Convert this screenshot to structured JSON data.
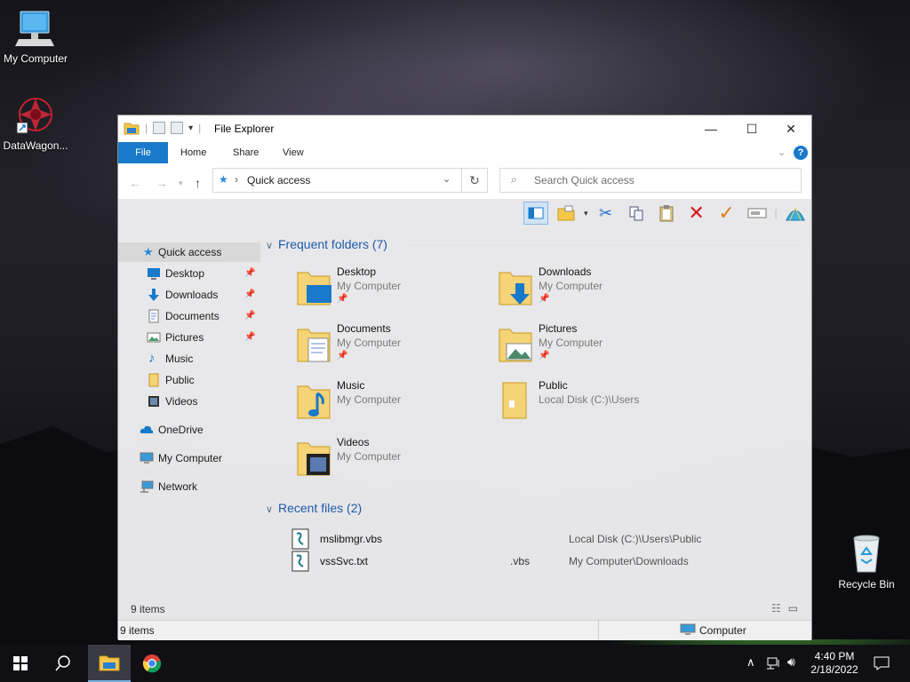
{
  "desktop": {
    "icons": [
      {
        "label": "My Computer",
        "icon": "computer-icon"
      },
      {
        "label": "DataWagon...",
        "icon": "app-shortcut-icon"
      },
      {
        "label": "Recycle Bin",
        "icon": "recycle-bin-icon"
      }
    ]
  },
  "window": {
    "title": "File Explorer",
    "controls": {
      "minimize": "—",
      "maximize": "☐",
      "close": "✕"
    },
    "ribbon_tabs": [
      "File",
      "Home",
      "Share",
      "View"
    ],
    "address": {
      "location_icon": "star-icon",
      "path": "Quick access"
    },
    "search_placeholder": "Search Quick access",
    "toolbar_icons": [
      "preview-pane-icon",
      "new-folder-icon",
      "cut-icon",
      "copy-icon",
      "paste-icon",
      "delete-icon",
      "checkmark-icon",
      "rename-icon",
      "shell-icon"
    ],
    "sidebar": [
      {
        "label": "Quick access",
        "icon": "star-icon",
        "selected": true,
        "pinned": false
      },
      {
        "label": "Desktop",
        "icon": "desktop-icon",
        "pinned": true
      },
      {
        "label": "Downloads",
        "icon": "download-icon",
        "pinned": true
      },
      {
        "label": "Documents",
        "icon": "document-icon",
        "pinned": true
      },
      {
        "label": "Pictures",
        "icon": "pictures-icon",
        "pinned": true
      },
      {
        "label": "Music",
        "icon": "music-icon",
        "pinned": false
      },
      {
        "label": "Public",
        "icon": "folder-icon",
        "pinned": false
      },
      {
        "label": "Videos",
        "icon": "video-icon",
        "pinned": false
      },
      {
        "label": "OneDrive",
        "icon": "cloud-icon",
        "pinned": false
      },
      {
        "label": "My Computer",
        "icon": "computer-icon",
        "pinned": false
      },
      {
        "label": "Network",
        "icon": "network-icon",
        "pinned": false
      }
    ],
    "frequent": {
      "header": "Frequent folders (7)",
      "items": [
        {
          "name": "Desktop",
          "location": "My Computer",
          "pinned": true,
          "icon": "desktop-folder-icon"
        },
        {
          "name": "Downloads",
          "location": "My Computer",
          "pinned": true,
          "icon": "downloads-folder-icon"
        },
        {
          "name": "Documents",
          "location": "My Computer",
          "pinned": true,
          "icon": "documents-folder-icon"
        },
        {
          "name": "Pictures",
          "location": "My Computer",
          "pinned": true,
          "icon": "pictures-folder-icon"
        },
        {
          "name": "Music",
          "location": "My Computer",
          "pinned": false,
          "icon": "music-folder-icon"
        },
        {
          "name": "Public",
          "location": "Local Disk (C:)\\Users",
          "pinned": false,
          "icon": "public-folder-icon"
        },
        {
          "name": "Videos",
          "location": "My Computer",
          "pinned": false,
          "icon": "videos-folder-icon"
        }
      ]
    },
    "recent": {
      "header": "Recent files (2)",
      "items": [
        {
          "name": "mslibmgr.vbs",
          "ext": "",
          "path": "Local Disk (C:)\\Users\\Public",
          "icon": "script-file-icon"
        },
        {
          "name": "vssSvc.txt",
          "ext": ".vbs",
          "path": "My Computer\\Downloads",
          "icon": "script-file-icon"
        }
      ]
    },
    "status_top": "9 items",
    "status_bottom": "9 items",
    "status_location": "Computer"
  },
  "taskbar": {
    "time": "4:40 PM",
    "date": "2/18/2022",
    "apps": [
      "start-icon",
      "search-icon",
      "file-explorer-icon",
      "chrome-icon"
    ]
  },
  "colors": {
    "accent": "#1979ca",
    "section_header": "#1e5aa8"
  }
}
